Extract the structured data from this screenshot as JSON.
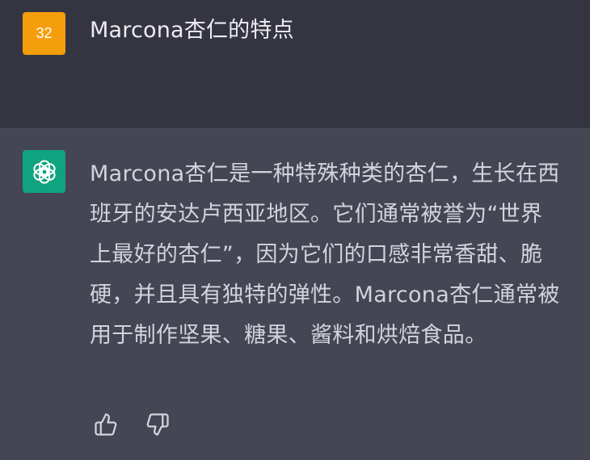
{
  "conversation": {
    "user_message": {
      "avatar_text": "32",
      "avatar_color": "#f59e0b",
      "text": "Marcona杏仁的特点"
    },
    "assistant_message": {
      "avatar_icon": "openai-logo-icon",
      "avatar_color": "#10a37f",
      "text": "Marcona杏仁是一种特殊种类的杏仁，生长在西班牙的安达卢西亚地区。它们通常被誉为“世界上最好的杏仁”，因为它们的口感非常香甜、脆硬，并且具有独特的弹性。Marcona杏仁通常被用于制作坚果、糖果、酱料和烘焙食品。"
    },
    "feedback": {
      "thumbs_up_icon": "thumbs-up-icon",
      "thumbs_down_icon": "thumbs-down-icon"
    }
  },
  "colors": {
    "user_bg": "#343541",
    "assistant_bg": "#444654",
    "text_primary": "#ececf1",
    "text_secondary": "#d1d5db"
  }
}
